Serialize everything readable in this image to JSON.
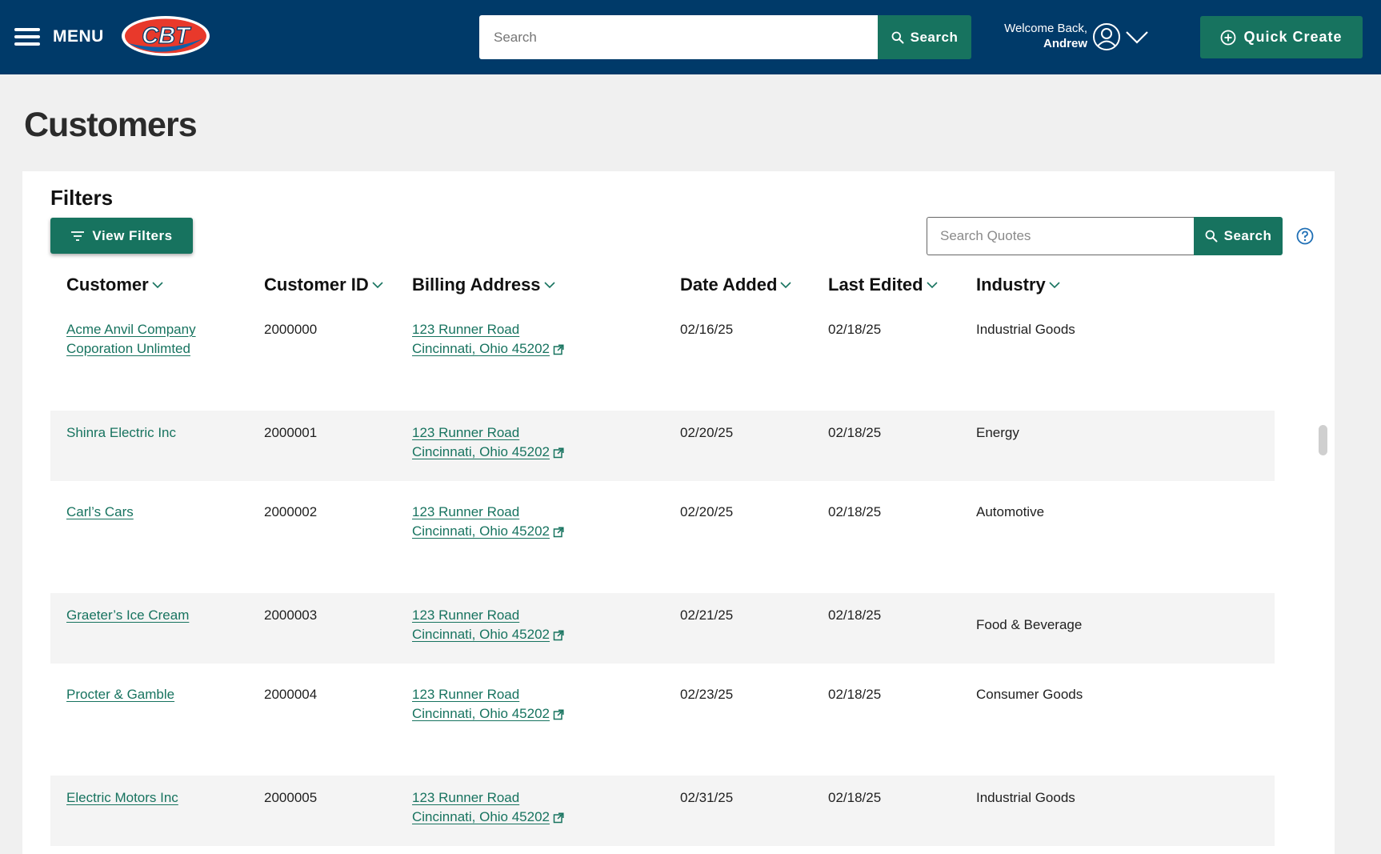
{
  "header": {
    "menu_label": "MENU",
    "logo_text": "CBT",
    "search": {
      "placeholder": "Search",
      "button_label": "Search"
    },
    "welcome_line": "Welcome Back,",
    "user_name": "Andrew",
    "quick_create_label": "Quick Create",
    "colors": {
      "nav_bg": "#003a69",
      "accent": "#17735f",
      "logo_red": "#e8392b"
    }
  },
  "page": {
    "title": "Customers"
  },
  "filters": {
    "title": "Filters",
    "view_filters_label": "View Filters",
    "search": {
      "placeholder": "Search Quotes",
      "button_label": "Search"
    }
  },
  "table": {
    "columns": [
      {
        "label": "Customer"
      },
      {
        "label": "Customer ID"
      },
      {
        "label": "Billing Address"
      },
      {
        "label": "Date Added"
      },
      {
        "label": "Last Edited"
      },
      {
        "label": "Industry"
      }
    ],
    "rows": [
      {
        "customer_line1": "Acme Anvil Company",
        "customer_line2": "Coporation Unlimted",
        "id": "2000000",
        "address_line1": "123 Runner Road",
        "address_line2": "Cincinnati, Ohio 45202",
        "date_added": "02/16/25",
        "last_edited": "02/18/25",
        "industry": "Industrial Goods"
      },
      {
        "customer_line1": "Shinra Electric Inc",
        "customer_line2": "",
        "id": "2000001",
        "address_line1": "123 Runner Road",
        "address_line2": "Cincinnati, Ohio 45202",
        "date_added": "02/20/25",
        "last_edited": "02/18/25",
        "industry": "Energy"
      },
      {
        "customer_line1": "Carl’s Cars",
        "customer_line2": "",
        "id": "2000002",
        "address_line1": "123 Runner Road",
        "address_line2": "Cincinnati, Ohio 45202",
        "date_added": "02/20/25",
        "last_edited": "02/18/25",
        "industry": "Automotive"
      },
      {
        "customer_line1": "Graeter’s Ice Cream",
        "customer_line2": "",
        "id": "2000003",
        "address_line1": "123 Runner Road",
        "address_line2": "Cincinnati, Ohio 45202",
        "date_added": "02/21/25",
        "last_edited": "02/18/25",
        "industry": "Food & Beverage"
      },
      {
        "customer_line1": "Procter & Gamble",
        "customer_line2": "",
        "id": "2000004",
        "address_line1": "123 Runner Road",
        "address_line2": "Cincinnati, Ohio 45202",
        "date_added": "02/23/25",
        "last_edited": "02/18/25",
        "industry": "Consumer Goods"
      },
      {
        "customer_line1": "Electric Motors Inc",
        "customer_line2": "",
        "id": "2000005",
        "address_line1": "123 Runner Road",
        "address_line2": "Cincinnati, Ohio 45202",
        "date_added": "02/31/25",
        "last_edited": "02/18/25",
        "industry": "Industrial Goods"
      }
    ]
  }
}
